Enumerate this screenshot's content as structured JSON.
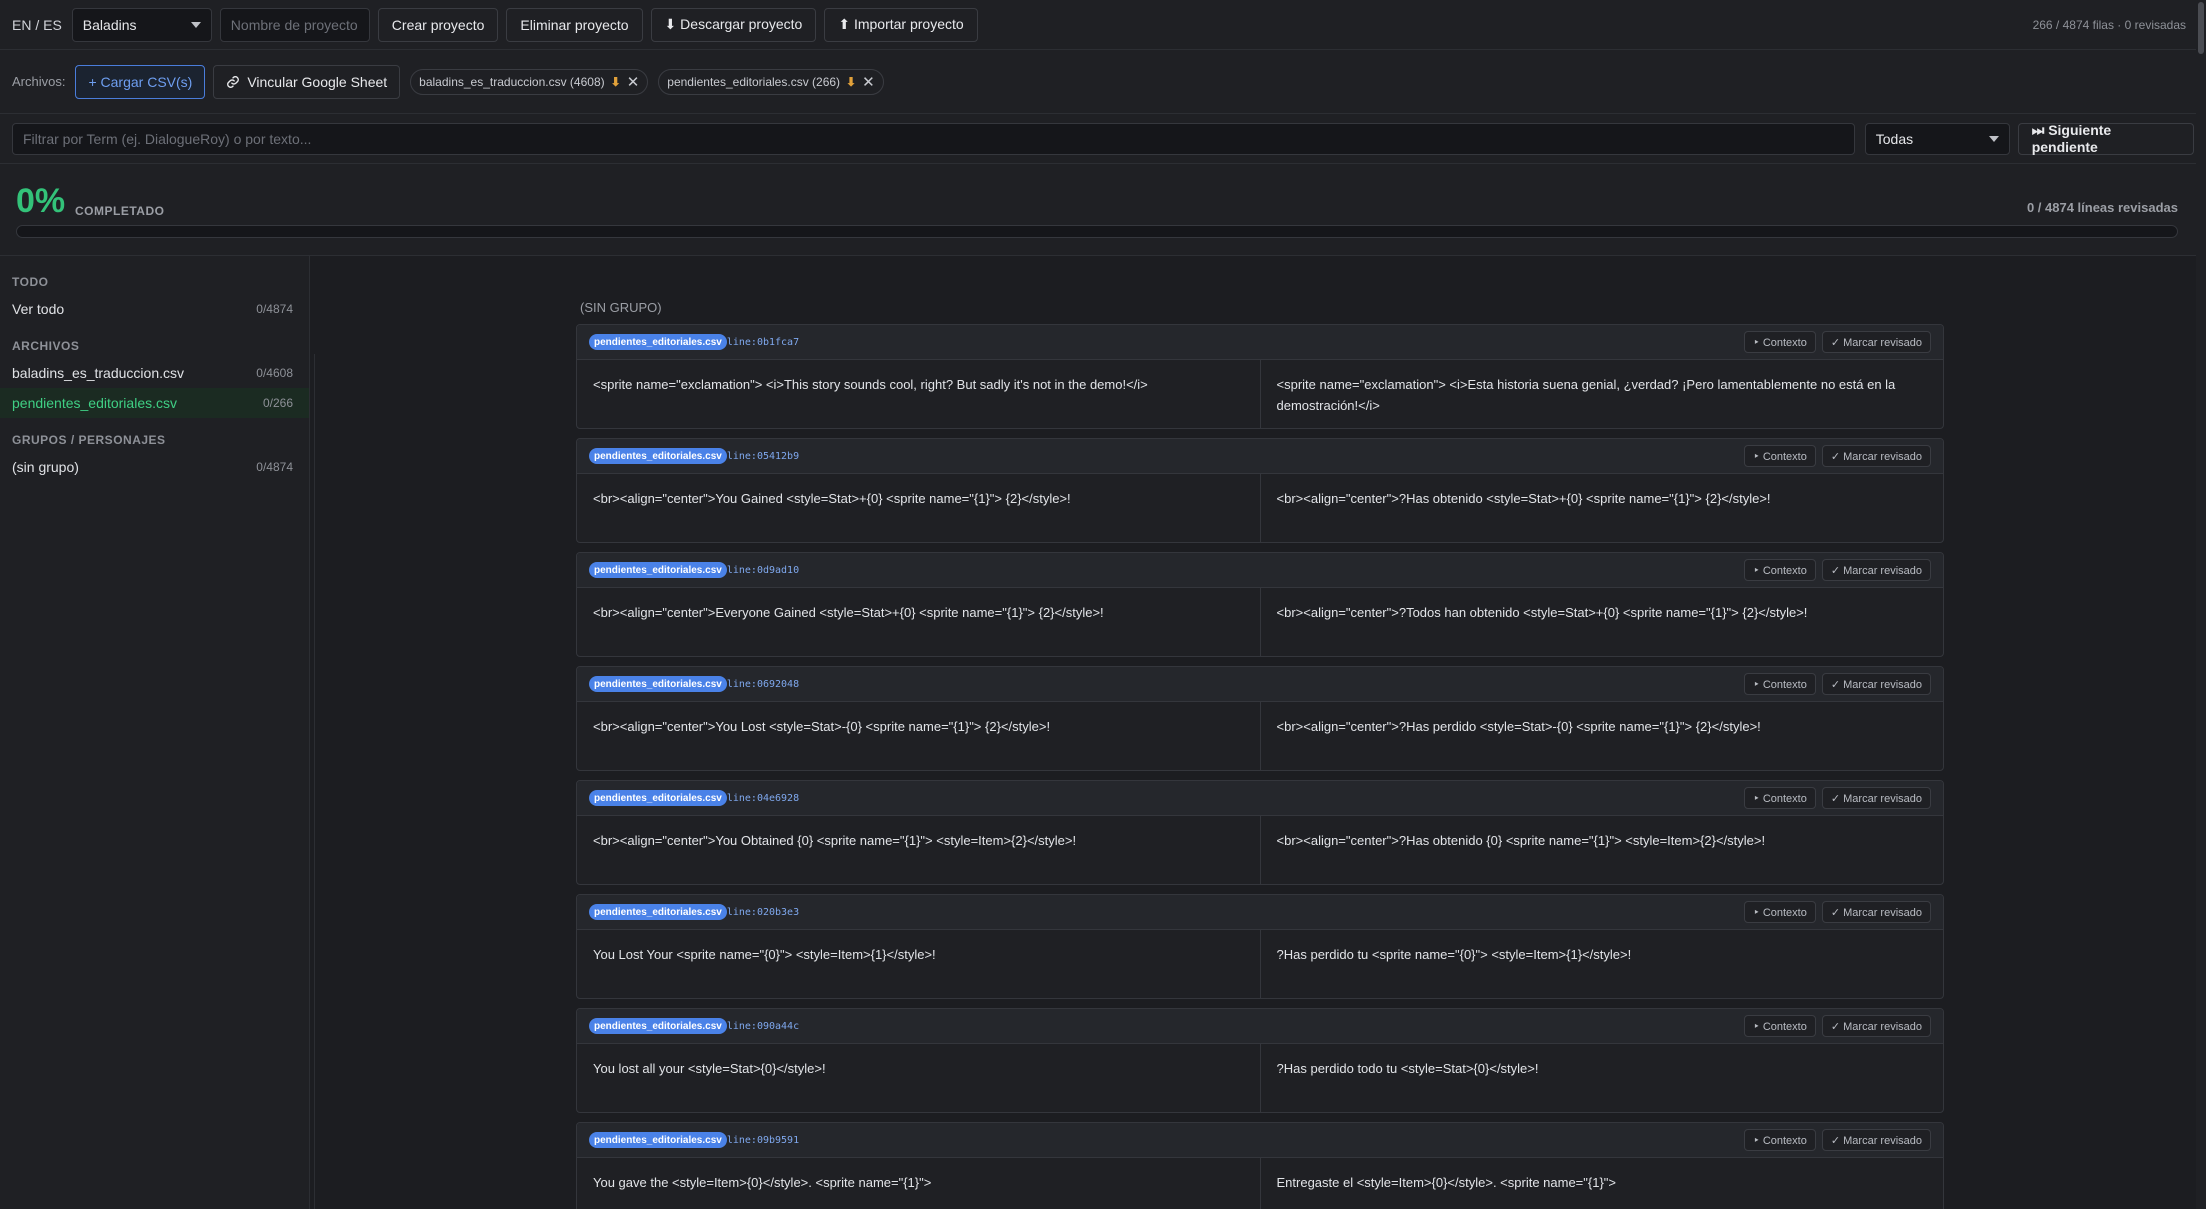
{
  "toolbar": {
    "lang": "EN / ES",
    "project_select": "Baladins",
    "project_name_placeholder": "Nombre de proyecto n",
    "create_label": "Crear proyecto",
    "delete_label": "Eliminar proyecto",
    "download_label": "⬇ Descargar proyecto",
    "import_label": "⬆ Importar proyecto",
    "row_count": "266 / 4874 filas · 0 revisadas"
  },
  "files": {
    "label": "Archivos:",
    "upload_label": "+ Cargar CSV(s)",
    "link_label": "Vincular Google Sheet",
    "chips": [
      {
        "name": "baladins_es_traduccion.csv (4608)"
      },
      {
        "name": "pendientes_editoriales.csv (266)"
      }
    ]
  },
  "filter": {
    "placeholder": "Filtrar por Term (ej. DialogueRoy) o por texto...",
    "select": "Todas",
    "next_label": "⏭ Siguiente pendiente"
  },
  "progress": {
    "percent": "0%",
    "label": "COMPLETADO",
    "lines": "0 / 4874 líneas revisadas",
    "fraction": 0
  },
  "sidebar": {
    "sections": [
      {
        "title": "TODO",
        "items": [
          {
            "label": "Ver todo",
            "count": "0/4874",
            "active": false
          }
        ]
      },
      {
        "title": "ARCHIVOS",
        "items": [
          {
            "label": "baladins_es_traduccion.csv",
            "count": "0/4608",
            "active": false
          },
          {
            "label": "pendientes_editoriales.csv",
            "count": "0/266",
            "active": true
          }
        ]
      },
      {
        "title": "GRUPOS / PERSONAJES",
        "items": [
          {
            "label": "(sin grupo)",
            "count": "0/4874",
            "active": false
          }
        ]
      }
    ]
  },
  "main": {
    "group_title": "(SIN GRUPO)",
    "context_label": "‣ Contexto",
    "review_label": "✓ Marcar revisado",
    "entries": [
      {
        "file": "pendientes_editoriales.csv",
        "term": "line:0b1fca7",
        "en": "<sprite name=\"exclamation\"> <i>This story sounds cool, right? But sadly it's not in the demo!</i>",
        "es": "<sprite name=\"exclamation\"> <i>Esta historia suena genial, ¿verdad? ¡Pero lamentablemente no está en la demostración!</i>"
      },
      {
        "file": "pendientes_editoriales.csv",
        "term": "line:05412b9",
        "en": "<br><align=\"center\">You Gained <style=Stat>+{0} <sprite name=\"{1}\"> {2}</style>!",
        "es": "<br><align=\"center\">?Has obtenido <style=Stat>+{0} <sprite name=\"{1}\"> {2}</style>!"
      },
      {
        "file": "pendientes_editoriales.csv",
        "term": "line:0d9ad10",
        "en": "<br><align=\"center\">Everyone Gained <style=Stat>+{0} <sprite name=\"{1}\"> {2}</style>!",
        "es": "<br><align=\"center\">?Todos han obtenido <style=Stat>+{0} <sprite name=\"{1}\"> {2}</style>!"
      },
      {
        "file": "pendientes_editoriales.csv",
        "term": "line:0692048",
        "en": "<br><align=\"center\">You Lost <style=Stat>-{0} <sprite name=\"{1}\"> {2}</style>!",
        "es": "<br><align=\"center\">?Has perdido <style=Stat>-{0} <sprite name=\"{1}\"> {2}</style>!"
      },
      {
        "file": "pendientes_editoriales.csv",
        "term": "line:04e6928",
        "en": "<br><align=\"center\">You Obtained {0} <sprite name=\"{1}\"> <style=Item>{2}</style>!",
        "es": "<br><align=\"center\">?Has obtenido {0} <sprite name=\"{1}\"> <style=Item>{2}</style>!"
      },
      {
        "file": "pendientes_editoriales.csv",
        "term": "line:020b3e3",
        "en": "You Lost Your <sprite name=\"{0}\"> <style=Item>{1}</style>!",
        "es": "?Has perdido tu <sprite name=\"{0}\"> <style=Item>{1}</style>!"
      },
      {
        "file": "pendientes_editoriales.csv",
        "term": "line:090a44c",
        "en": "You lost all your <style=Stat>{0}</style>!",
        "es": "?Has perdido todo tu <style=Stat>{0}</style>!"
      },
      {
        "file": "pendientes_editoriales.csv",
        "term": "line:09b9591",
        "en": "You gave the <style=Item>{0}</style>. <sprite name=\"{1}\">",
        "es": "Entregaste el <style=Item>{0}</style>. <sprite name=\"{1}\">"
      }
    ]
  },
  "colors": {
    "accent": "#4a82e8",
    "success": "#33c279",
    "warning": "#e2a13a"
  }
}
